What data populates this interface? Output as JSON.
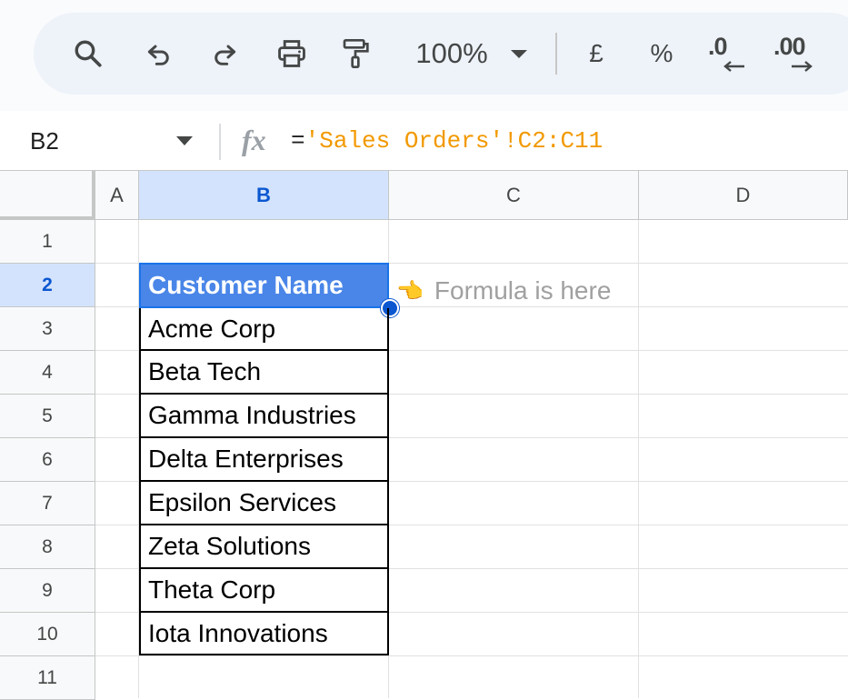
{
  "toolbar": {
    "zoom": "100%",
    "currency": "£",
    "percent": "%",
    "decrease_decimal": ".0",
    "increase_decimal": ".00",
    "icons": [
      "search-icon",
      "undo-icon",
      "redo-icon",
      "print-icon",
      "paint-format-icon"
    ]
  },
  "formula_bar": {
    "name_box": "B2",
    "fx": "fx",
    "formula_eq": "=",
    "formula_ref": "'Sales Orders'!C2:C11"
  },
  "grid": {
    "columns": [
      "A",
      "B",
      "C",
      "D"
    ],
    "rows": [
      "1",
      "2",
      "3",
      "4",
      "5",
      "6",
      "7",
      "8",
      "9",
      "10",
      "11"
    ],
    "selected_column": "B",
    "selected_row": "2",
    "header_cell": "Customer Name",
    "customers": [
      "Acme Corp",
      "Beta Tech",
      "Gamma Industries",
      "Delta Enterprises",
      "Epsilon Services",
      "Zeta Solutions",
      "Theta Corp",
      "Iota Innovations"
    ],
    "annotation": "Formula is here",
    "annotation_icon": "👈"
  },
  "colors": {
    "accent": "#0b57d0",
    "header_fill": "#4a86e8",
    "formula_ref": "#f29900",
    "selection_bg": "#d3e3fd"
  }
}
